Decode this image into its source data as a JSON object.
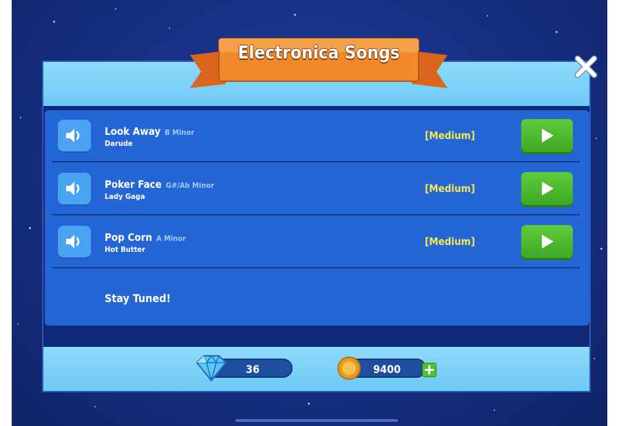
{
  "title": "Electronica Songs",
  "songs": [
    {
      "name": "Look Away",
      "key": "B Minor",
      "artist": "Darude",
      "difficulty": "[Medium]"
    },
    {
      "name": "Poker Face",
      "key": "G#/Ab Minor",
      "artist": "Lady Gaga",
      "difficulty": "[Medium]"
    },
    {
      "name": "Pop Corn",
      "key": "A Minor",
      "artist": "Hot Butter",
      "difficulty": "[Medium]"
    }
  ],
  "footer_message": "Stay Tuned!",
  "currency": {
    "gems": "36",
    "coins": "9400"
  },
  "colors": {
    "background": "#172f82",
    "panel_header": "#7dd3f8",
    "list": "#2566d6",
    "difficulty": "#f6e94a",
    "play_button": "#4fbd2e",
    "banner": "#f28a2b"
  },
  "icons": [
    "close-icon",
    "speaker-icon",
    "play-icon",
    "gem-icon",
    "coin-icon",
    "plus-icon"
  ]
}
